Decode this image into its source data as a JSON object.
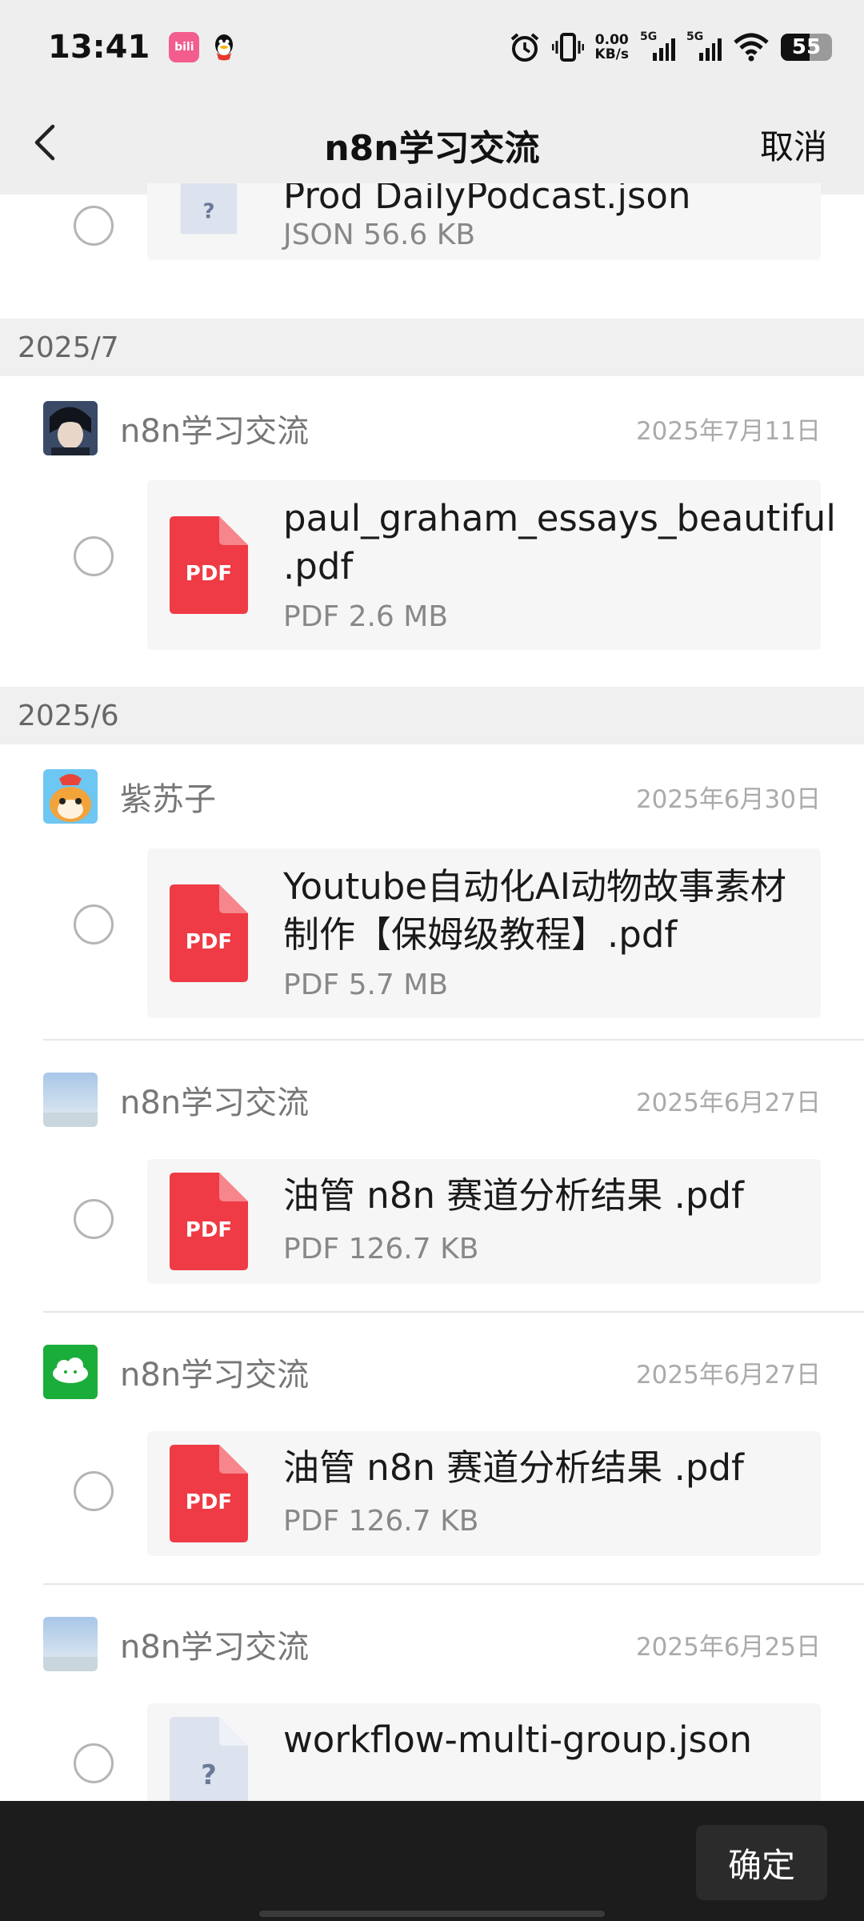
{
  "status_bar": {
    "time": "13:41",
    "app_badge": "bili",
    "net_speed_value": "0.00",
    "net_speed_unit": "KB/s",
    "signal_1_label": "5G",
    "signal_2_label": "5G",
    "battery": "55",
    "icons": [
      "bilibili-icon",
      "qq-icon",
      "alarm-icon",
      "vibrate-icon",
      "signal-icon",
      "wifi-icon",
      "battery-icon"
    ]
  },
  "nav": {
    "title": "n8n学习交流",
    "cancel_label": "取消"
  },
  "top_partial_file": {
    "name": "Prod DailyPodcast.json",
    "meta": "JSON 56.6 KB"
  },
  "groups": [
    {
      "month": "2025/7",
      "messages": [
        {
          "sender": "n8n学习交流",
          "date": "2025年7月11日",
          "file_name": "paul_graham_essays_beautiful.pdf",
          "file_name_line1": "paul_graham_essays_beautiful",
          "file_name_line2": ".pdf",
          "file_meta": "PDF 2.6 MB"
        }
      ]
    },
    {
      "month": "2025/6",
      "messages": [
        {
          "sender": "紫苏子",
          "date": "2025年6月30日",
          "file_name_line1": "Youtube自动化AI动物故事素材",
          "file_name_line2": "制作【保姆级教程】.pdf",
          "file_meta": "PDF 5.7 MB"
        },
        {
          "sender": "n8n学习交流",
          "date": "2025年6月27日",
          "file_name": "油管 n8n 赛道分析结果 .pdf",
          "file_meta": "PDF 126.7 KB"
        },
        {
          "sender": "n8n学习交流",
          "date": "2025年6月27日",
          "file_name": "油管 n8n 赛道分析结果 .pdf",
          "file_meta": "PDF 126.7 KB"
        },
        {
          "sender": "n8n学习交流",
          "date": "2025年6月25日",
          "file_name": "workflow-multi-group.json",
          "file_meta": ""
        }
      ]
    }
  ],
  "pdf_label": "PDF",
  "unknown_file_glyph": "?",
  "bottom_bar": {
    "confirm_label": "确定"
  },
  "colors": {
    "pdf_red": "#ef3b45",
    "bar_bg": "#eeeeee",
    "bottom_bg": "#1c1c1c"
  }
}
